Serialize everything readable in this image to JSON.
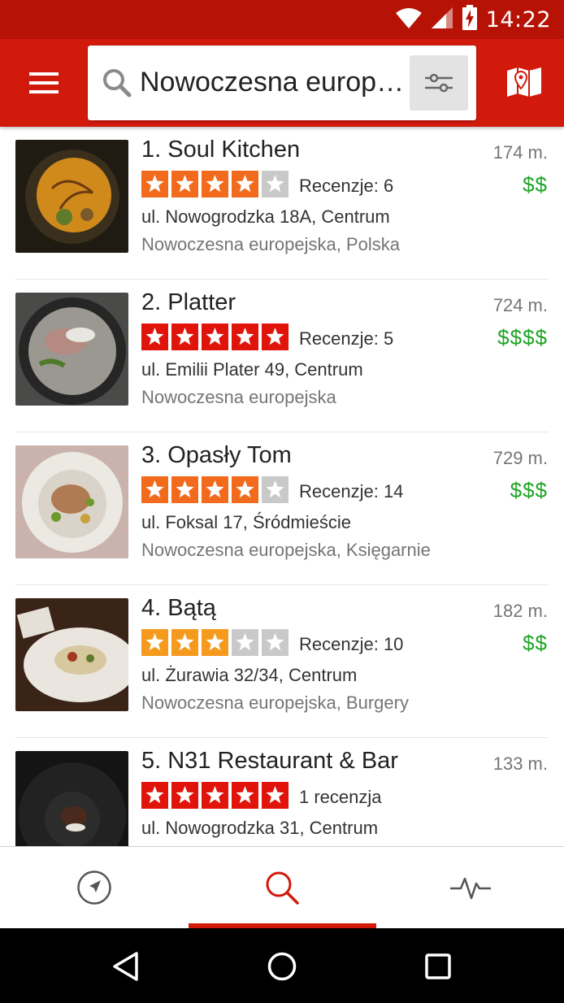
{
  "status_bar": {
    "time": "14:22"
  },
  "search": {
    "query": "Nowoczesna europejska"
  },
  "restaurants": [
    {
      "name": "1. Soul Kitchen",
      "distance": "174 m.",
      "rating": 4,
      "reviews": "Recenzje: 6",
      "price": "$$",
      "address": "ul. Nowogrodzka 18A, Centrum",
      "category": "Nowoczesna europejska, Polska"
    },
    {
      "name": "2. Platter",
      "distance": "724 m.",
      "rating": 5,
      "reviews": "Recenzje: 5",
      "price": "$$$$",
      "address": "ul. Emilii Plater 49, Centrum",
      "category": "Nowoczesna europejska"
    },
    {
      "name": "3. Opasły Tom",
      "distance": "729 m.",
      "rating": 4,
      "reviews": "Recenzje: 14",
      "price": "$$$",
      "address": "ul. Foksal 17, Śródmieście",
      "category": "Nowoczesna europejska, Księgarnie"
    },
    {
      "name": "4. Bątą",
      "distance": "182 m.",
      "rating": 3,
      "reviews": "Recenzje: 10",
      "price": "$$",
      "address": "ul. Żurawia 32/34, Centrum",
      "category": "Nowoczesna europejska, Burgery"
    },
    {
      "name": "5. N31 Restaurant & Bar",
      "distance": "133 m.",
      "rating": 5,
      "reviews": "1 recenzja",
      "price": "",
      "address": "ul. Nowogrodzka 31, Centrum",
      "category": ""
    }
  ],
  "bottom_nav": {
    "active_tab": "search"
  },
  "colors": {
    "brand_red": "#d21a0c",
    "price_green": "#1fa526",
    "star_orange": "#f26b1d",
    "star_red": "#e0140a",
    "star_amber": "#f59a1d",
    "star_empty": "#c9c9c9"
  }
}
